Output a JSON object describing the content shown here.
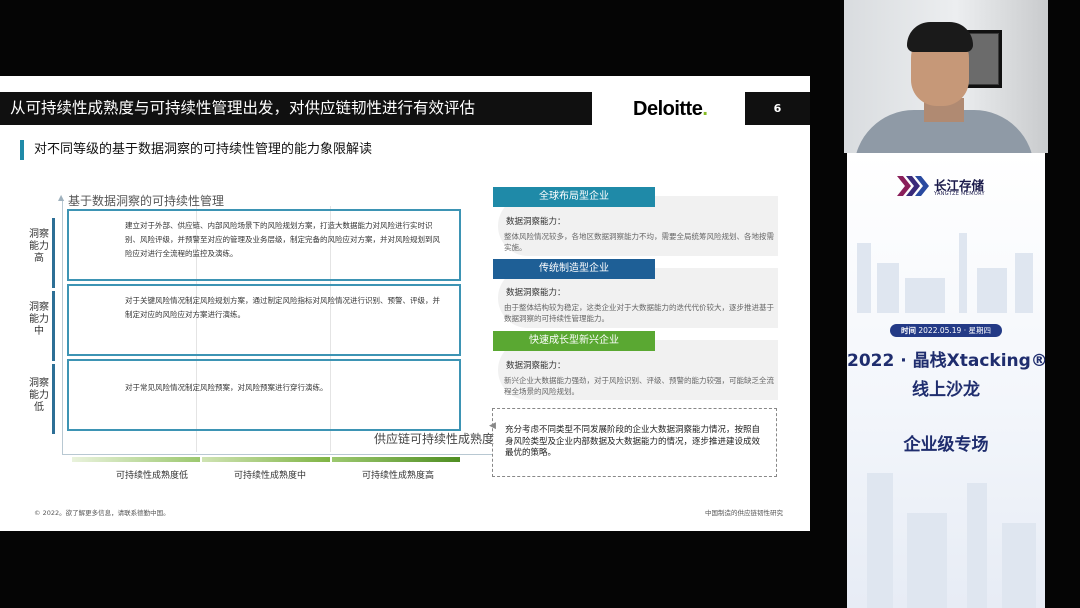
{
  "slide": {
    "title": "从可持续性成熟度与可持续性管理出发，对供应链韧性进行有效评估",
    "logo_text": "Deloitte",
    "logo_dot": ".",
    "page_number": "6",
    "subtitle": "对不同等级的基于数据洞察的可持续性管理的能力象限解读",
    "y_axis_label": "基于数据洞察的可持续性管理",
    "x_axis_label": "供应链可持续性成熟度",
    "capability_levels": [
      {
        "label": "洞察能力高",
        "text": "建立对于外部、供应链、内部风险场景下的风险规划方案，打造大数据能力对风险进行实时识别、风险评级，并预警至对应的管理及业务层级，制定完备的风险应对方案，并对风险规划到风险应对进行全流程的监控及演练。"
      },
      {
        "label": "洞察能力中",
        "text": "对于关键风险情况制定风险规划方案，通过制定风险指标对风险情况进行识别、预警、评级，并制定对应的风险应对方案进行演练。"
      },
      {
        "label": "洞察能力低",
        "text": "对于常见风险情况制定风险预案，对风险预案进行穿行演练。"
      }
    ],
    "maturity_levels": [
      "可持续性成熟度低",
      "可持续性成熟度中",
      "可持续性成熟度高"
    ],
    "enterprise_types": [
      {
        "name": "全球布局型企业",
        "heading": "数据洞察能力：",
        "desc": "整体风险情况较多，各地区数据洞察能力不均，需要全局统筹风险规划、各地按需实施。",
        "color": "#1f8aa8"
      },
      {
        "name": "传统制造型企业",
        "heading": "数据洞察能力：",
        "desc": "由于整体结构较为稳定，这类企业对于大数据能力的迭代代价较大，逐步推进基于数据洞察的可持续性管理能力。",
        "color": "#1e5f96"
      },
      {
        "name": "快速成长型新兴企业",
        "heading": "数据洞察能力：",
        "desc": "新兴企业大数据能力强劲，对于风险识别、评级、预警的能力较强，可能缺乏全流程全场景的风险规划。",
        "color": "#5aa832"
      }
    ],
    "conclusion": "充分考虑不同类型不同发展阶段的企业大数据洞察能力情况，按照自身风险类型及企业内部数据及大数据能力的情况，逐步推进建设成效最优的策略。",
    "copyright": "© 2022。欲了解更多信息，请联系德勤中国。",
    "report_name": "中国制造的供应链韧性研究"
  },
  "promo": {
    "company_name": "长江存储",
    "company_en": "YANGTZE MEMORY",
    "date_label": "时间",
    "date_value": "2022.05.19 · 星期四",
    "event_name": "2022 · 晶栈Xtacking®",
    "event_subtitle": "线上沙龙",
    "session": "企业级专场"
  },
  "colors": {
    "deloitte_green": "#86bc25",
    "accent_teal": "#1f8aa8",
    "promo_blue": "#1f2d6e"
  }
}
